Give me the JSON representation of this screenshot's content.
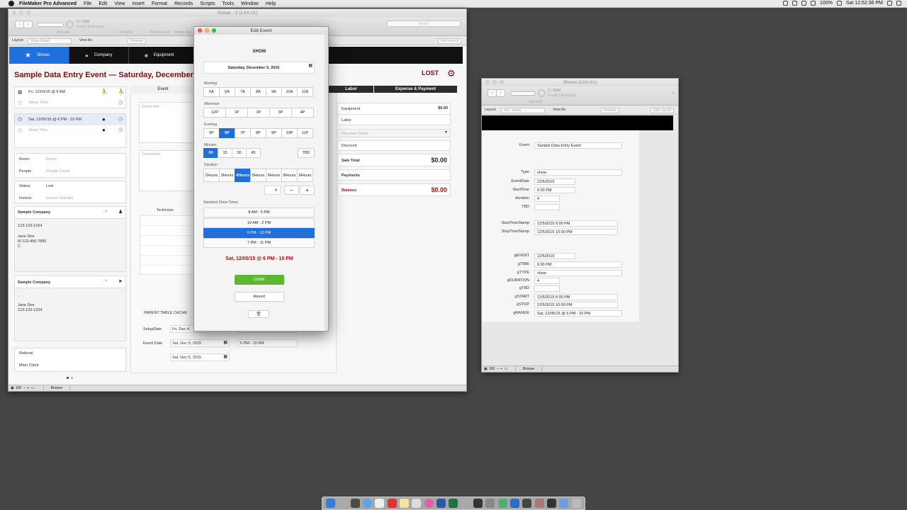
{
  "menubar": {
    "app": "FileMaker Pro Advanced",
    "items": [
      "File",
      "Edit",
      "View",
      "Insert",
      "Format",
      "Records",
      "Scripts",
      "Tools",
      "Window",
      "Help"
    ],
    "battery": "100%",
    "clock": "Sat 12:52:36 PM"
  },
  "main_window": {
    "title": "Shows - 2 (LAX-01)",
    "record_count": "2 / 1338",
    "found_state": "Found (Unsorted)",
    "records_label": "Records",
    "toolbar_labels": [
      "Show All",
      "New Record",
      "Delete Rec"
    ],
    "search_placeholder": "Search",
    "layout_label": "Layout:",
    "layout_value": "Show Detail",
    "view_as_label": "View As:",
    "preview_label": "Preview",
    "edit_layout_label": "Edit Layout",
    "nav_tabs": [
      "Shows",
      "Company",
      "Equipment"
    ],
    "event_heading": "Sample Data Entry Event — Saturday, December 05, 20",
    "status_heading": "LOST",
    "setup_date_row": "Fri, 12/04/15 @ 8 AM",
    "setup_time_placeholder": "Setup Time",
    "show_date_row": "Sat, 12/05/15 @ 6 PM - 10 PM",
    "show_time_placeholder": "Show Time",
    "room_label": "Room",
    "room_placeholder": "Room",
    "people_label": "People",
    "people_placeholder": "People Count",
    "status_label": "Status",
    "status_value": "Lost",
    "invoice_label": "Invoice",
    "invoice_placeholder": "Invoice Number",
    "company1_name": "Sample Company",
    "company1_phone": "123-123-1234",
    "contact1_name": "Jane Doe",
    "contact1_mobile": "M 123-456-7890",
    "contact1_extra": "C",
    "company2_name": "Sample Company",
    "company2_dot": ",",
    "contact2_name": "Jane Doe",
    "contact2_phone": "123-123-1234",
    "referral_label": "Referral",
    "main_client_label": "Main Client",
    "tab_event": "Event",
    "tab_labor": "Labor",
    "tab_expense": "Expense & Payment",
    "event_info_placeholder": "Event Info",
    "comments_placeholder": "Comments",
    "technician_label": "Technician",
    "parent_table_label": "PARENT TABLE CACHE",
    "setupdate_label": "SetupDate",
    "setupdate_value": "Fri, Dec 4,",
    "eventdate_label": "Event Date",
    "eventdate_value": "Sat, Dec 5, 2015",
    "eventtime_value": "6 PM - 10 PM",
    "date3_value": "Sat, Dec 5, 2015",
    "equipment_label": "Equipment",
    "equipment_amount": "$0.00",
    "labor_label": "Labor",
    "discount_terms_placeholder": "Discount Terms",
    "discount_label": "Discount",
    "sale_total_label": "Sale Total",
    "sale_total_value": "$0.00",
    "payments_label": "Payments",
    "balance_label": "Balance",
    "balance_value": "$0.00",
    "zoom": "100",
    "mode": "Browse"
  },
  "dialog": {
    "title": "Edit Event",
    "type_label": "SHOW",
    "date_value": "Saturday, December 5, 2015",
    "morning_label": "Morning",
    "morning": [
      "5A",
      "6A",
      "7A",
      "8A",
      "9A",
      "10A",
      "11A"
    ],
    "afternoon_label": "Afternoon",
    "afternoon": [
      "12P",
      "1P",
      "2P",
      "3P",
      "4P"
    ],
    "evening_label": "Evening",
    "evening": [
      "5P",
      "6P",
      "7P",
      "8P",
      "9P",
      "10P",
      "11P"
    ],
    "evening_selected": "6P",
    "minutes_label": "Minutes",
    "minutes": [
      "00",
      "15",
      "30",
      "45"
    ],
    "minutes_selected": "00",
    "tbd_label": "TBD",
    "duration_label": "Duration",
    "durations": [
      {
        "n": "2",
        "u": "Hours"
      },
      {
        "n": "3",
        "u": "Hours"
      },
      {
        "n": "4",
        "u": "Hours"
      },
      {
        "n": "5",
        "u": "Hours"
      },
      {
        "n": "6",
        "u": "Hours"
      },
      {
        "n": "8",
        "u": "Hours"
      },
      {
        "n": "9",
        "u": "Hours"
      }
    ],
    "duration_selected": "4",
    "duration_value": "4",
    "minus_label": "−",
    "plus_label": "+",
    "standard_label": "Standard Show Times",
    "standard_times": [
      "8 AM - 5 PM",
      "10 AM - 2 PM",
      "6 PM - 10 PM",
      "7 PM - 11 PM"
    ],
    "standard_selected": "6 PM - 10 PM",
    "summary": "Sat, 12/05/15 @ 6 PM - 10 PM",
    "done_label": "DONE",
    "revert_label": "Revert"
  },
  "second_window": {
    "title": "Shows (LAX-01)",
    "record_count": "2 / 2644",
    "found_state": "Found (Unsorted)",
    "records_label": "Records",
    "layout_label": "Layout:",
    "layout_value": "ssx - event",
    "view_as_label": "View As:",
    "preview_label": "Preview",
    "edit_layout_label": "Edit Layout",
    "fields": [
      {
        "label": "Event",
        "value": "Sample Data Entry Event"
      },
      {
        "label": "Type",
        "value": "show"
      },
      {
        "label": "EventDate",
        "value": "12/5/2015"
      },
      {
        "label": "StartTime",
        "value": "6:00 PM"
      },
      {
        "label": "duration",
        "value": "4"
      },
      {
        "label": "TBD",
        "value": ""
      },
      {
        "label": "StartTimeStamp",
        "value": "12/5/2015 6:00 PM"
      },
      {
        "label": "StopTimeStamp",
        "value": "12/5/2015 10:00 PM"
      },
      {
        "label": "gEVENT",
        "value": "12/5/2015"
      },
      {
        "label": "gTIME",
        "value": "6:00 PM"
      },
      {
        "label": "gTYPE",
        "value": "show"
      },
      {
        "label": "gDURATION",
        "value": "4"
      },
      {
        "label": "gTBD",
        "value": ""
      },
      {
        "label": "gSTART",
        "value": "12/5/2015 6:00 PM"
      },
      {
        "label": "gSTOP",
        "value": "12/5/2015 10:00 PM"
      },
      {
        "label": "gRANGE",
        "value": "Sat, 12/05/15 @ 6 PM - 10 PM"
      }
    ],
    "zoom": "100",
    "mode": "Browse"
  },
  "colors": {
    "accent": "#1f6fdc",
    "heading": "#7a1010",
    "done": "#5cb82e"
  }
}
